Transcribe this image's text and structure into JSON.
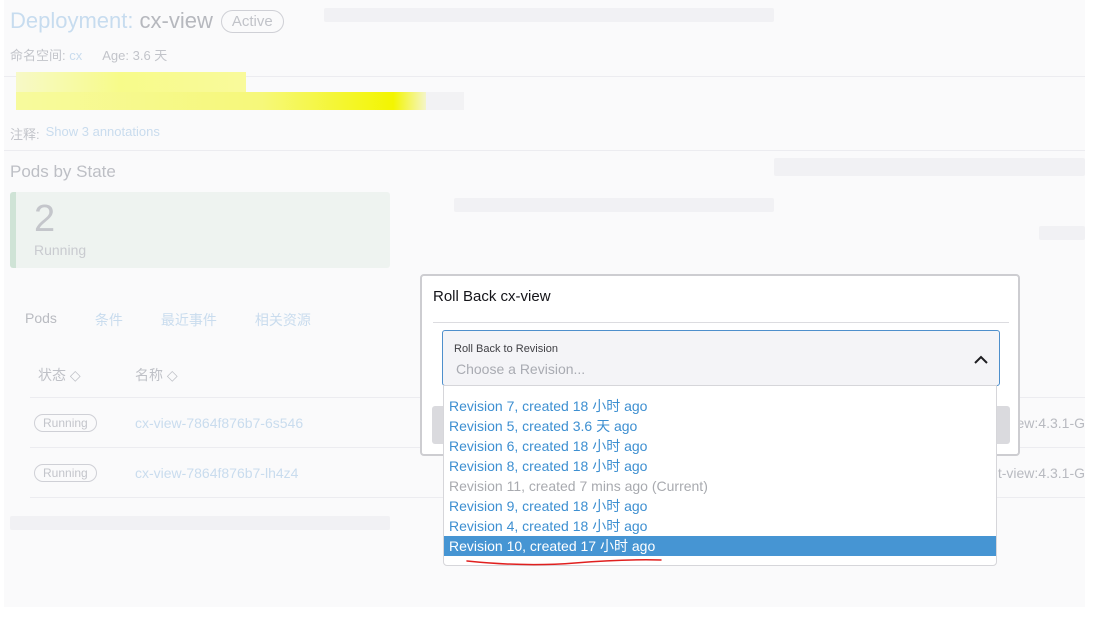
{
  "header": {
    "kind": "Deployment:",
    "name": "cx-view",
    "status": "Active"
  },
  "meta": {
    "namespace_label": "命名空间:",
    "namespace_value": "cx",
    "age_label": "Age:",
    "age_value": "3.6 天"
  },
  "annotations": {
    "label": "注释:",
    "link": "Show 3 annotations"
  },
  "pods_by_state": {
    "title": "Pods by State",
    "count": "2",
    "state": "Running"
  },
  "tabs": [
    {
      "label": "Pods"
    },
    {
      "label": "条件"
    },
    {
      "label": "最近事件"
    },
    {
      "label": "相关资源"
    }
  ],
  "table": {
    "columns": [
      "状态 ◇",
      "名称 ◇"
    ],
    "rows": [
      {
        "status": "Running",
        "name": "cx-view-7864f876b7-6s546",
        "image": "iew:4.3.1-G"
      },
      {
        "status": "Running",
        "name": "cx-view-7864f876b7-lh4z4",
        "image": "t-view:4.3.1-G"
      }
    ]
  },
  "modal": {
    "title": "Roll Back cx-view",
    "select_label": "Roll Back to Revision",
    "select_placeholder": "Choose a Revision..."
  },
  "dropdown": {
    "options": [
      {
        "label": "Revision 7, created 18 小时 ago"
      },
      {
        "label": "Revision 5, created 3.6 天 ago"
      },
      {
        "label": "Revision 6, created 18 小时 ago"
      },
      {
        "label": "Revision 8, created 18 小时 ago"
      },
      {
        "label": "Revision 11, created 7 mins ago (Current)"
      },
      {
        "label": "Revision 9, created 18 小时 ago"
      },
      {
        "label": "Revision 4, created 18 小时 ago"
      },
      {
        "label": "Revision 10, created 17 小时 ago"
      }
    ]
  },
  "colors": {
    "accent": "#4695d3",
    "annotation_underline": "#e0201f"
  }
}
